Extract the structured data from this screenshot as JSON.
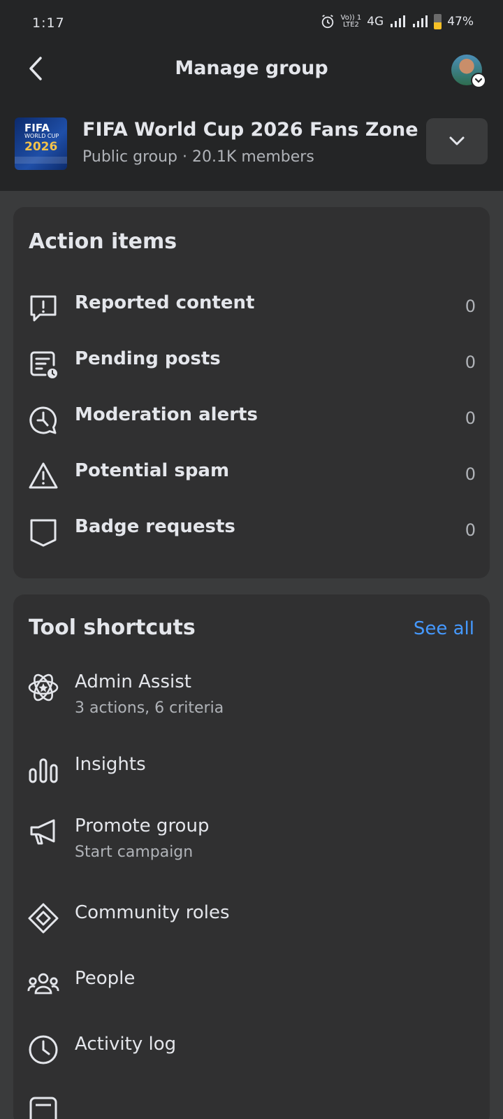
{
  "status_bar": {
    "time": "1:17",
    "network_label_top": "Vo)) 1",
    "network_label_bottom": "LTE2",
    "network_type": "4G",
    "battery": "47%"
  },
  "header": {
    "title": "Manage group",
    "back_icon": "back-arrow-icon",
    "avatar_icon": "profile-avatar"
  },
  "group": {
    "name": "FIFA World Cup 2026 Fans Zone",
    "meta": "Public group · 20.1K members",
    "thumb_line1": "FIFA",
    "thumb_line2": "WORLD CUP",
    "thumb_line3": "2026",
    "dropdown_icon": "chevron-down-icon"
  },
  "action_items": {
    "title": "Action items",
    "items": [
      {
        "label": "Reported content",
        "count": "0",
        "icon": "report-bubble-icon"
      },
      {
        "label": "Pending posts",
        "count": "0",
        "icon": "pending-post-icon"
      },
      {
        "label": "Moderation alerts",
        "count": "0",
        "icon": "moderation-alert-icon"
      },
      {
        "label": "Potential spam",
        "count": "0",
        "icon": "warning-triangle-icon"
      },
      {
        "label": "Badge requests",
        "count": "0",
        "icon": "badge-shield-icon"
      }
    ]
  },
  "tool_shortcuts": {
    "title": "Tool shortcuts",
    "see_all": "See all",
    "items": [
      {
        "label": "Admin Assist",
        "sub": "3 actions, 6 criteria",
        "icon": "admin-assist-icon"
      },
      {
        "label": "Insights",
        "sub": "",
        "icon": "bar-chart-icon"
      },
      {
        "label": "Promote group",
        "sub": "Start campaign",
        "icon": "megaphone-icon"
      },
      {
        "label": "Community roles",
        "sub": "",
        "icon": "diamond-icon"
      },
      {
        "label": "People",
        "sub": "",
        "icon": "people-icon"
      },
      {
        "label": "Activity log",
        "sub": "",
        "icon": "clock-icon"
      }
    ]
  },
  "colors": {
    "background": "#3a3b3c",
    "header_bg": "#242526",
    "card_bg": "#303031",
    "accent": "#4599ff"
  }
}
